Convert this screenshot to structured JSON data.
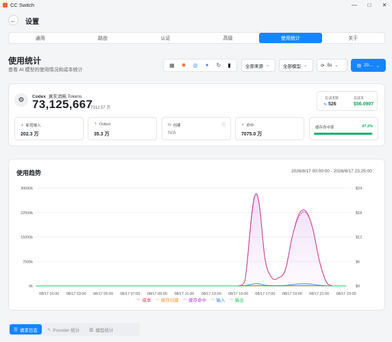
{
  "app": {
    "title": "CC Switch"
  },
  "window": {
    "minimize": "—",
    "maximize": "□",
    "close": "✕"
  },
  "header": {
    "back_icon": "←",
    "title": "设置"
  },
  "tabs": [
    {
      "label": "通用"
    },
    {
      "label": "路由"
    },
    {
      "label": "认证"
    },
    {
      "label": "高级"
    },
    {
      "label": "使用统计"
    },
    {
      "label": "关于"
    }
  ],
  "page": {
    "title": "使用统计",
    "subtitle": "查看 AI 模型的使用情况和成本统计"
  },
  "filters": {
    "provider_icons": [
      "grid-icon",
      "claude-icon",
      "openai-icon",
      "gemini-icon",
      "refresh-circle-icon",
      "panel-icon"
    ],
    "source": "全部来源",
    "model": "全部模型",
    "refresh": "5s",
    "date": "20…"
  },
  "summary": {
    "source": "Codex",
    "label": "真实消耗 Tokens",
    "total": "73,125,667",
    "approx": "≈ 7312.57 万",
    "requests_label": "总请求数",
    "requests": "526",
    "cost_label": "总成本",
    "cost": "$56.0907",
    "stats": [
      {
        "label": "新增输入",
        "value": "202.3 万"
      },
      {
        "label": "Output",
        "value": "35.3 万"
      },
      {
        "label": "创建",
        "value": "N/A"
      },
      {
        "label": "命中",
        "value": "7075.0 万"
      }
    ],
    "cache_rate_label": "缓存命中率",
    "cache_rate": "97.2%",
    "cache_rate_fraction": 0.972
  },
  "chart_data": {
    "type": "line",
    "title": "使用趋势",
    "range_text": "2026/8/17 00:00:00 - 2026/8/17 23:25:00",
    "x_ticks": [
      "08/17 01:00",
      "08/17 03:00",
      "08/17 05:00",
      "08/17 07:00",
      "08/17 09:00",
      "08/17 11:00",
      "08/17 13:00",
      "08/17 15:00",
      "08/17 17:00",
      "08/17 19:00",
      "08/17 21:00",
      "08/17 23:00"
    ],
    "y_left_ticks": [
      "30000k",
      "22500k",
      "15000k",
      "7500k",
      "0k"
    ],
    "y_right_ticks": [
      "$24",
      "$18",
      "$12",
      "$6",
      "$0"
    ],
    "ylim": [
      0,
      30000
    ],
    "y2lim": [
      0,
      24
    ],
    "x": [
      0,
      1,
      2,
      3,
      4,
      5,
      6,
      7,
      8,
      9,
      10,
      11,
      12,
      13,
      14,
      15,
      15.5,
      16,
      16.3,
      16.6,
      17,
      17.5,
      18,
      18.5,
      19,
      19.5,
      20,
      20.5,
      21,
      21.5,
      22,
      23
    ],
    "series": [
      {
        "name": "缓存命中",
        "color": "#b044d8",
        "values": [
          0,
          0,
          0,
          0,
          0,
          0,
          0,
          0,
          0,
          0,
          0,
          0,
          0,
          0,
          0,
          0,
          1500,
          22000,
          28200,
          24000,
          8000,
          2500,
          2500,
          5000,
          15000,
          22000,
          23000,
          18000,
          8000,
          1500,
          0,
          0
        ]
      },
      {
        "name": "成本",
        "color": "#e3364f",
        "values": [
          0,
          0,
          0,
          0,
          0,
          0,
          0,
          0,
          0,
          0,
          0,
          0,
          0,
          0,
          0,
          0,
          1.2,
          17,
          22.5,
          19,
          6.4,
          2,
          2,
          4,
          12,
          17,
          18,
          14.4,
          6.4,
          1.2,
          0,
          0
        ]
      },
      {
        "name": "缓存创建",
        "color": "#f29b30",
        "values": [
          0,
          0,
          0,
          0,
          0,
          0,
          0,
          0,
          0,
          0,
          0,
          0,
          0,
          0,
          0,
          0,
          0,
          0,
          0,
          0,
          0,
          0,
          0,
          0,
          0,
          0,
          0,
          0,
          0,
          0,
          0,
          0
        ]
      },
      {
        "name": "输入",
        "color": "#3b82f6",
        "values": [
          0,
          0,
          0,
          0,
          0,
          0,
          0,
          0,
          0,
          0,
          0,
          0,
          0,
          0,
          0,
          0,
          100,
          500,
          700,
          600,
          200,
          100,
          100,
          150,
          400,
          600,
          650,
          500,
          200,
          50,
          0,
          0
        ]
      },
      {
        "name": "输出",
        "color": "#22c55e",
        "values": [
          0,
          0,
          0,
          0,
          0,
          0,
          0,
          0,
          0,
          0,
          0,
          0,
          0,
          0,
          0,
          0,
          20,
          80,
          100,
          90,
          40,
          20,
          20,
          30,
          70,
          90,
          95,
          80,
          40,
          10,
          0,
          0
        ]
      }
    ],
    "legend": [
      {
        "name": "成本",
        "color": "#e3364f"
      },
      {
        "name": "缓存创建",
        "color": "#f29b30"
      },
      {
        "name": "缓存命中",
        "color": "#b044d8"
      },
      {
        "name": "输入",
        "color": "#3b82f6"
      },
      {
        "name": "输出",
        "color": "#22c55e"
      }
    ]
  },
  "bottom_tabs": [
    {
      "label": "请求日志",
      "icon": "list-icon"
    },
    {
      "label": "Provider 统计",
      "icon": "activity-icon"
    },
    {
      "label": "模型统计",
      "icon": "bar-chart-icon"
    }
  ]
}
